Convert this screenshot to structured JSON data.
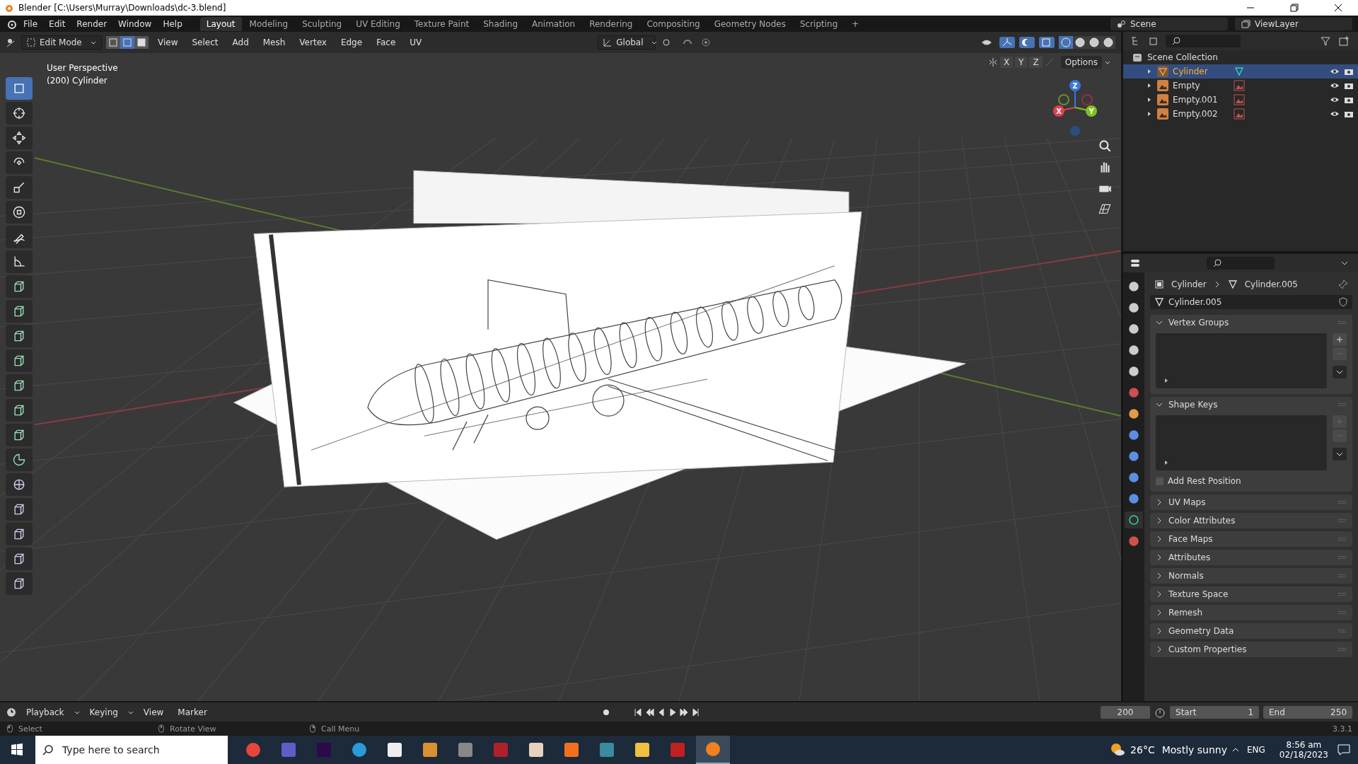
{
  "window": {
    "title": "Blender [C:\\Users\\Murray\\Downloads\\dc-3.blend]"
  },
  "menu": [
    "File",
    "Edit",
    "Render",
    "Window",
    "Help"
  ],
  "workspaces": [
    {
      "label": "Layout",
      "selected": true
    },
    {
      "label": "Modeling",
      "selected": false
    },
    {
      "label": "Sculpting",
      "selected": false
    },
    {
      "label": "UV Editing",
      "selected": false
    },
    {
      "label": "Texture Paint",
      "selected": false
    },
    {
      "label": "Shading",
      "selected": false
    },
    {
      "label": "Animation",
      "selected": false
    },
    {
      "label": "Rendering",
      "selected": false
    },
    {
      "label": "Compositing",
      "selected": false
    },
    {
      "label": "Geometry Nodes",
      "selected": false
    },
    {
      "label": "Scripting",
      "selected": false
    }
  ],
  "add_workspace": "+",
  "scene": "Scene",
  "view_layer": "ViewLayer",
  "header": {
    "mode": "Edit Mode",
    "select_modes": [
      {
        "kind": "vertex",
        "selected": false
      },
      {
        "kind": "edge",
        "selected": true
      },
      {
        "kind": "face",
        "selected": false
      }
    ],
    "menus": [
      "View",
      "Select",
      "Add",
      "Mesh",
      "Vertex",
      "Edge",
      "Face",
      "UV"
    ],
    "orientation": "Global",
    "shading": [
      {
        "kind": "wireframe",
        "selected": true
      },
      {
        "kind": "solid",
        "selected": false
      },
      {
        "kind": "material",
        "selected": false
      },
      {
        "kind": "rendered",
        "selected": false
      }
    ],
    "axes": [
      "X",
      "Y",
      "Z"
    ],
    "options": "Options"
  },
  "viewport": {
    "info": [
      "User Perspective",
      "(200) Cylinder"
    ],
    "gizmo": [
      "X",
      "Y",
      "Z"
    ]
  },
  "tools": [
    {
      "kind": "select",
      "selected": true
    },
    {
      "kind": "cursor",
      "selected": false
    },
    {
      "kind": "move",
      "selected": false
    },
    {
      "kind": "rotate",
      "selected": false
    },
    {
      "kind": "scale",
      "selected": false
    },
    {
      "kind": "transform",
      "selected": false
    },
    {
      "kind": "annotate",
      "selected": false
    },
    {
      "kind": "measure",
      "selected": false
    },
    {
      "kind": "add-cube",
      "selected": false
    },
    {
      "kind": "extrude",
      "selected": false
    },
    {
      "kind": "inset",
      "selected": false
    },
    {
      "kind": "bevel",
      "selected": false
    },
    {
      "kind": "loop-cut",
      "selected": false
    },
    {
      "kind": "knife",
      "selected": false
    },
    {
      "kind": "poly-build",
      "selected": false
    },
    {
      "kind": "spin",
      "selected": false
    },
    {
      "kind": "smooth",
      "selected": false
    },
    {
      "kind": "edge-slide",
      "selected": false
    },
    {
      "kind": "shrink",
      "selected": false
    },
    {
      "kind": "shear",
      "selected": false
    },
    {
      "kind": "rip",
      "selected": false
    }
  ],
  "outliner": {
    "root": "Scene Collection",
    "items": [
      {
        "name": "Cylinder",
        "kind": "mesh",
        "selected": true
      },
      {
        "name": "Empty",
        "kind": "empty",
        "selected": false
      },
      {
        "name": "Empty.001",
        "kind": "empty",
        "selected": false
      },
      {
        "name": "Empty.002",
        "kind": "empty",
        "selected": false
      }
    ]
  },
  "properties": {
    "breadcrumb": [
      "Cylinder",
      "Cylinder.005"
    ],
    "datablock": "Cylinder.005",
    "tabs": [
      {
        "kind": "tool",
        "selected": false
      },
      {
        "kind": "render",
        "selected": false
      },
      {
        "kind": "output",
        "selected": false
      },
      {
        "kind": "view-layer",
        "selected": false
      },
      {
        "kind": "scene",
        "selected": false
      },
      {
        "kind": "world",
        "selected": false
      },
      {
        "kind": "object",
        "selected": false
      },
      {
        "kind": "modifier",
        "selected": false
      },
      {
        "kind": "particles",
        "selected": false
      },
      {
        "kind": "physics",
        "selected": false
      },
      {
        "kind": "constraints",
        "selected": false
      },
      {
        "kind": "data",
        "selected": true
      },
      {
        "kind": "material",
        "selected": false
      }
    ],
    "panels": [
      {
        "title": "Vertex Groups",
        "expanded": true,
        "kind": "list"
      },
      {
        "title": "Shape Keys",
        "expanded": true,
        "kind": "list",
        "checkbox": {
          "label": "Add Rest Position",
          "checked": false
        }
      },
      {
        "title": "UV Maps",
        "expanded": false,
        "kind": "plain"
      },
      {
        "title": "Color Attributes",
        "expanded": false,
        "kind": "plain"
      },
      {
        "title": "Face Maps",
        "expanded": false,
        "kind": "plain"
      },
      {
        "title": "Attributes",
        "expanded": false,
        "kind": "plain"
      },
      {
        "title": "Normals",
        "expanded": false,
        "kind": "plain"
      },
      {
        "title": "Texture Space",
        "expanded": false,
        "kind": "plain"
      },
      {
        "title": "Remesh",
        "expanded": false,
        "kind": "plain"
      },
      {
        "title": "Geometry Data",
        "expanded": false,
        "kind": "plain"
      },
      {
        "title": "Custom Properties",
        "expanded": false,
        "kind": "plain"
      }
    ]
  },
  "timeline": {
    "menus": [
      "Playback",
      "Keying",
      "View",
      "Marker"
    ],
    "current_frame": "200",
    "start_label": "Start",
    "start": "1",
    "end_label": "End",
    "end": "250"
  },
  "status_bar": {
    "hints": [
      "Select",
      "Rotate View",
      "Call Menu"
    ],
    "version": "3.3.1"
  },
  "taskbar": {
    "search": {
      "placeholder": "Type here to search"
    },
    "apps": [
      {
        "kind": "chrome",
        "selected": false
      },
      {
        "kind": "teams",
        "selected": false
      },
      {
        "kind": "premiere",
        "selected": false
      },
      {
        "kind": "edge",
        "selected": false
      },
      {
        "kind": "file",
        "selected": false
      },
      {
        "kind": "game",
        "selected": false
      },
      {
        "kind": "car",
        "selected": false
      },
      {
        "kind": "arcade",
        "selected": false
      },
      {
        "kind": "anime",
        "selected": false
      },
      {
        "kind": "nodes",
        "selected": false
      },
      {
        "kind": "nox",
        "selected": false
      },
      {
        "kind": "folder",
        "selected": false
      },
      {
        "kind": "shield",
        "selected": false
      },
      {
        "kind": "blender",
        "selected": true
      }
    ],
    "temperature": "26°C",
    "weather": "Mostly sunny",
    "language": "ENG",
    "time": "8:56 am",
    "date": "02/18/2023"
  }
}
